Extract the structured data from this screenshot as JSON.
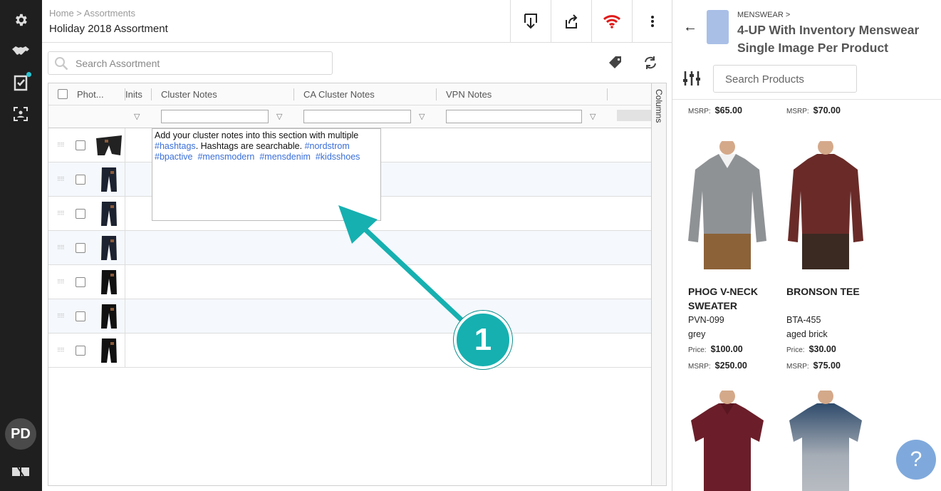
{
  "app": {
    "breadcrumb": "Home > Assortments",
    "title": "Holiday 2018 Assortment",
    "avatar_initials": "PD",
    "accent_color": "#16b0b0"
  },
  "nav": {
    "icons": [
      "gear-icon",
      "handshake-icon",
      "checklist-icon",
      "image-frame-icon",
      "tag-logo-icon"
    ]
  },
  "header": {
    "buttons": [
      "download-icon",
      "share-icon",
      "wifi-icon",
      "more-vertical-icon"
    ]
  },
  "search": {
    "placeholder": "Search Assortment"
  },
  "grid": {
    "columns": [
      "Phot...",
      "Inits",
      "Cluster Notes",
      "CA Cluster Notes",
      "VPN Notes"
    ],
    "side_label": "Columns",
    "row_count": 7
  },
  "note_popup": {
    "line1": "Add your cluster notes into this section with multiple",
    "tag1": "#hashtags",
    "line2": ". Hashtags are searchable. ",
    "tag2": "#nordstrom",
    "tag3": "#bpactive",
    "tag4": "#mensmodern",
    "tag5": "#mensdenim",
    "tag6": "#kidsshoes"
  },
  "callout": {
    "number": "1"
  },
  "panel": {
    "category": "MENSWEAR >",
    "title": "4-UP With Inventory Menswear Single Image Per Product",
    "search_placeholder": "Search Products",
    "msrp_label": "MSRP:",
    "price_label": "Price:",
    "top_row": [
      {
        "msrp": "$65.00"
      },
      {
        "msrp": "$70.00"
      }
    ],
    "products": [
      {
        "name": "PHOG V-NECK SWEATER",
        "code": "PVN-099",
        "color": "grey",
        "price": "$100.00",
        "msrp": "$250.00"
      },
      {
        "name": "BRONSON TEE",
        "code": "BTA-455",
        "color": "aged brick",
        "price": "$30.00",
        "msrp": "$75.00"
      }
    ]
  },
  "help": {
    "label": "?"
  }
}
